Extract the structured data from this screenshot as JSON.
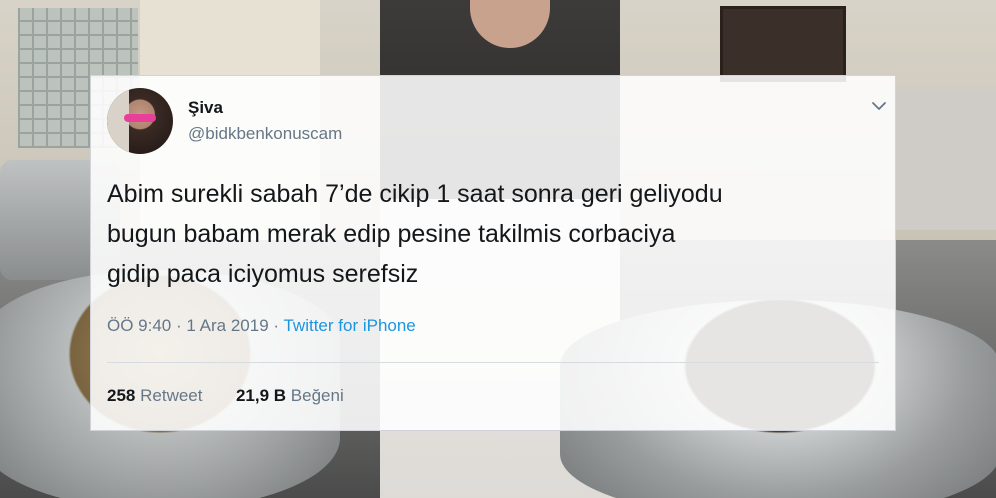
{
  "tweet": {
    "display_name": "Şiva",
    "handle": "@bidkbenkonuscam",
    "text": "Abim surekli sabah 7’de cikip 1 saat sonra geri geliyodu\nbugun babam merak edip pesine takilmis corbaciya\ngidip paca iciyomus serefsiz",
    "time": "ÖÖ 9:40",
    "separator": "·",
    "date": "1 Ara 2019",
    "source": "Twitter for iPhone",
    "retweet_count": "258",
    "retweet_label": "Retweet",
    "like_count": "21,9 B",
    "like_label": "Beğeni"
  },
  "icons": {
    "menu": "chevron-down-icon",
    "avatar": "avatar"
  },
  "colors": {
    "text": "#14171a",
    "muted": "#657786",
    "link": "#1b95e0"
  }
}
